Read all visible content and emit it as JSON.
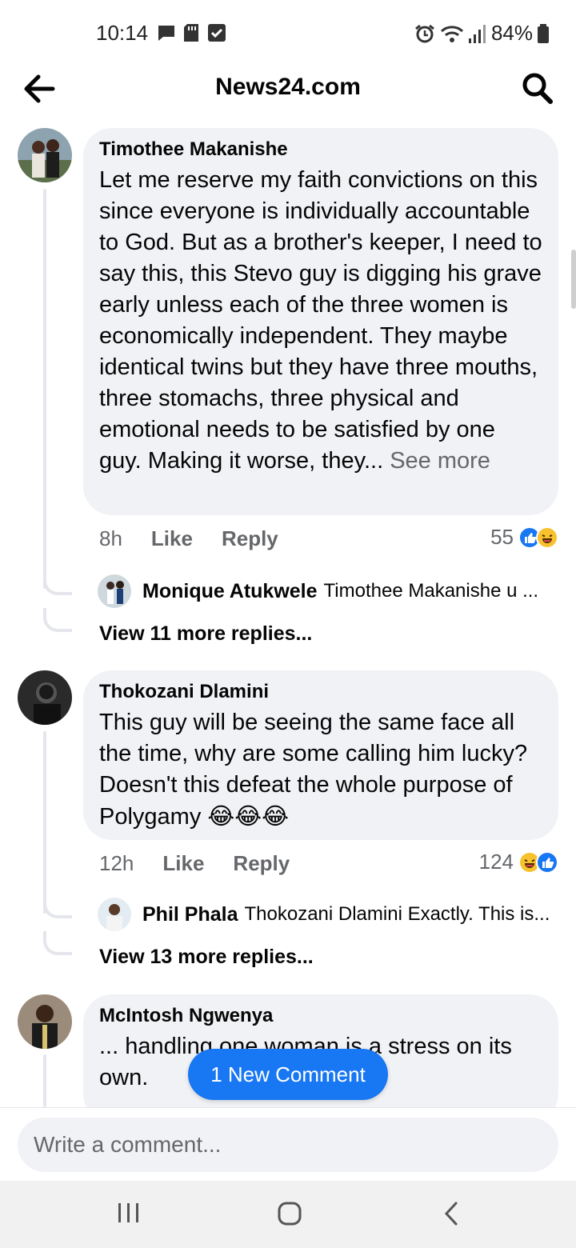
{
  "status_bar": {
    "time": "10:14",
    "battery": "84%"
  },
  "header": {
    "title": "News24.com"
  },
  "comments": [
    {
      "author": "Timothee Makanishe",
      "text": "Let me reserve my faith convictions on this since everyone is individually accountable to God. But as a brother's keeper, I need to say this, this Stevo guy is digging his grave early unless each of the three women is economically independent. They maybe identical twins but they have three mouths, three stomachs, three physical and emotional needs to be satisfied by one guy. Making it worse, they...",
      "see_more": "See more",
      "time": "8h",
      "like": "Like",
      "reply": "Reply",
      "reaction_count": "55",
      "reply_preview": {
        "author": "Monique Atukwele",
        "text": "Timothee Makanishe u ..."
      },
      "view_more": "View 11 more replies..."
    },
    {
      "author": "Thokozani Dlamini",
      "text": "This guy will be seeing the same face all the time, why are some calling him lucky?  Doesn't this defeat the whole purpose of Polygamy",
      "emoji": "😂😂😂",
      "time": "12h",
      "like": "Like",
      "reply": "Reply",
      "reaction_count": "124",
      "reply_preview": {
        "author": "Phil Phala",
        "text": "Thokozani Dlamini Exactly. This is..."
      },
      "view_more": "View 13 more replies..."
    },
    {
      "author": "McIntosh Ngwenya",
      "text": "... handling one woman is a stress on its own."
    }
  ],
  "new_comment_label": "1 New Comment",
  "composer": {
    "placeholder": "Write a comment..."
  },
  "colors": {
    "accent": "#1877f2",
    "bubble": "#f0f2f5",
    "muted_text": "#65676b"
  }
}
